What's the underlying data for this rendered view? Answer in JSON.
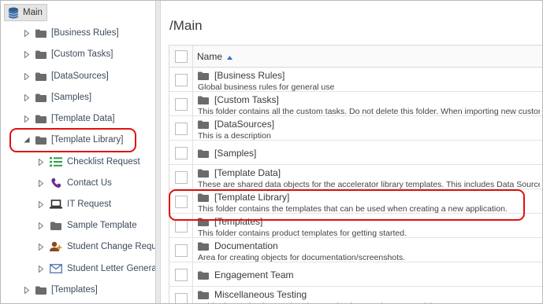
{
  "tree": {
    "root": {
      "label": "Main"
    },
    "items": [
      {
        "label": "[Business Rules]"
      },
      {
        "label": "[Custom Tasks]"
      },
      {
        "label": "[DataSources]"
      },
      {
        "label": "[Samples]"
      },
      {
        "label": "[Template Data]"
      },
      {
        "label": "[Template Library]"
      }
    ],
    "children": [
      {
        "label": "Checklist Request",
        "icon": "checklist-icon"
      },
      {
        "label": "Contact Us",
        "icon": "phone-icon"
      },
      {
        "label": "IT Request",
        "icon": "laptop-icon"
      },
      {
        "label": "Sample Template",
        "icon": "folder-icon"
      },
      {
        "label": "Student Change Reques",
        "icon": "user-add-icon"
      },
      {
        "label": "Student Letter Generati",
        "icon": "envelope-icon"
      }
    ],
    "last": {
      "label": "[Templates]"
    }
  },
  "main": {
    "path": "/Main",
    "header": {
      "name_label": "Name"
    },
    "rows": [
      {
        "title": "[Business Rules]",
        "desc": "Global business rules for general use"
      },
      {
        "title": "[Custom Tasks]",
        "desc": "This folder contains all the custom tasks. Do not delete this folder. When importing new custom"
      },
      {
        "title": "[DataSources]",
        "desc": "This is a description"
      },
      {
        "title": "[Samples]",
        "desc": ""
      },
      {
        "title": "[Template Data]",
        "desc": "These are shared data objects for the accelerator library templates. This includes Data Sources"
      },
      {
        "title": "[Template Library]",
        "desc": "This folder contains the templates that can be used when creating a new application."
      },
      {
        "title": "[Templates]",
        "desc": "This folder contains product templates for getting started."
      },
      {
        "title": "Documentation",
        "desc": "Area for creating objects for documentation/screenshots."
      },
      {
        "title": "Engagement Team",
        "desc": ""
      },
      {
        "title": "Miscellaneous Testing",
        "desc": "Folder for testing issues that do not arise from Tech Support Tickets"
      }
    ]
  },
  "colors": {
    "highlight": "#e01010",
    "folder": "#6b6b6b",
    "tree_text": "#3c4a5c"
  }
}
